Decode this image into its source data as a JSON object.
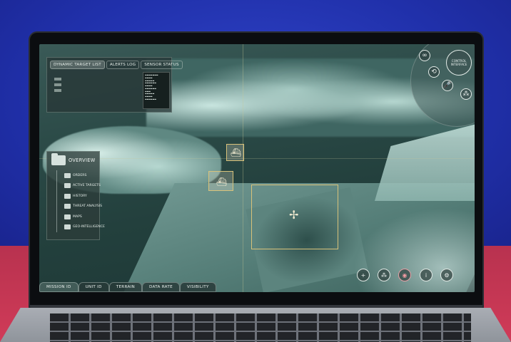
{
  "top_panel": {
    "tabs": [
      {
        "label": "DYNAMIC TARGET LIST",
        "active": true
      },
      {
        "label": "ALERTS LOG",
        "active": false
      },
      {
        "label": "SENSOR STATUS",
        "active": false
      }
    ]
  },
  "overview": {
    "title": "OVERVIEW",
    "items": [
      {
        "label": "ORDERS"
      },
      {
        "label": "ACTIVE TARGETS"
      },
      {
        "label": "HISTORY"
      },
      {
        "label": "THREAT ANALYSIS"
      },
      {
        "label": "MAPS"
      },
      {
        "label": "GEO-INTELLIGENCE"
      }
    ]
  },
  "control": {
    "label": "CONTROL INTERFACE",
    "icons": [
      "infinity-icon",
      "share-icon",
      "microphone-icon",
      "nodes-icon"
    ]
  },
  "bottom_tabs": [
    {
      "label": "MISSION ID",
      "active": true
    },
    {
      "label": "UNIT ID",
      "active": false
    },
    {
      "label": "TERRAIN",
      "active": false
    },
    {
      "label": "DATA RATE",
      "active": false
    },
    {
      "label": "VISIBILITY",
      "active": false
    }
  ],
  "bottom_buttons": [
    {
      "icon": "add-icon",
      "glyph": "+"
    },
    {
      "icon": "network-icon",
      "glyph": "⁂"
    },
    {
      "icon": "alert-target-icon",
      "glyph": "◉"
    },
    {
      "icon": "info-icon",
      "glyph": "i"
    },
    {
      "icon": "settings-icon",
      "glyph": "⚙"
    }
  ],
  "colors": {
    "target_box": "#d8c27a",
    "alert_button": "#e7a0a6",
    "background_blue": "#2433b4",
    "background_red": "#c8324f"
  }
}
